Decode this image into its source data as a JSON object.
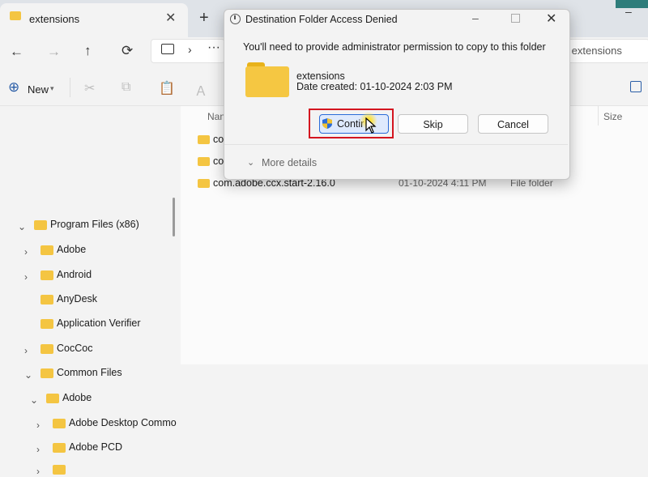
{
  "tab": {
    "label": "extensions",
    "close_glyph": "✕",
    "new_tab_glyph": "+"
  },
  "window": {
    "minimize_glyph": "–"
  },
  "nav": {
    "back": "←",
    "forward": "→",
    "up": "↑",
    "refresh": "⟳",
    "chevron": "›",
    "more": "···"
  },
  "search": {
    "placeholder": "rch extensions"
  },
  "commandbar": {
    "new_label": "New",
    "new_plus": "⊕",
    "caret": "▾",
    "cut": "✂",
    "copy": "⧉",
    "paste": "📋",
    "rename": "Ａ"
  },
  "sidebar": {
    "items": [
      {
        "label": "Program Files (x86)",
        "chev": "⌄"
      },
      {
        "label": "Adobe",
        "chev": "›"
      },
      {
        "label": "Android",
        "chev": "›"
      },
      {
        "label": "AnyDesk",
        "chev": ""
      },
      {
        "label": "Application Verifier",
        "chev": ""
      },
      {
        "label": "CocCoc",
        "chev": "›"
      },
      {
        "label": "Common Files",
        "chev": "⌄"
      },
      {
        "label": "Adobe",
        "chev": "⌄"
      },
      {
        "label": "Adobe Desktop Commo",
        "chev": "›"
      },
      {
        "label": "Adobe PCD",
        "chev": "›"
      },
      {
        "label": "",
        "chev": "›"
      }
    ]
  },
  "content": {
    "col_name": "Nan",
    "col_size": "Size",
    "rows": [
      {
        "name": "co",
        "date": "",
        "type": ""
      },
      {
        "name": "co",
        "date": "",
        "type": ""
      },
      {
        "name": "com.adobe.ccx.start-2.16.0",
        "date": "01-10-2024 4:11 PM",
        "type": "File folder"
      }
    ]
  },
  "dialog": {
    "title": "Destination Folder Access Denied",
    "message": "You'll need to provide administrator permission to copy to this folder",
    "folder_name": "extensions",
    "folder_date": "Date created: 01-10-2024 2:03 PM",
    "continue_label": "Contir",
    "skip_label": "Skip",
    "cancel_label": "Cancel",
    "more_details": "More details",
    "more_chevron": "⌄",
    "min_glyph": "–",
    "close_glyph": "✕"
  },
  "colors": {
    "highlight": "#d4151f",
    "folder": "#f4c542",
    "accent": "#2b6cd8"
  }
}
